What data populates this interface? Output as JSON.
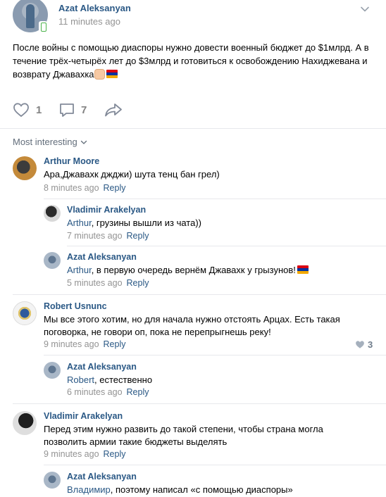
{
  "post": {
    "author": "Azat Aleksanyan",
    "time": "11 minutes ago",
    "text": "После войны с помощью диаспоры нужно довести военный бюджет до $1млрд. А в течение трёх-четырёх лет до $3млрд и готовиться к освобождению Нахиджевана и возврату Джавахка",
    "like_count": "1",
    "comment_count": "7",
    "icons": [
      "heart-icon",
      "comment-icon",
      "share-icon",
      "chevron-down-icon"
    ]
  },
  "comments_header": {
    "sort_label": "Most interesting"
  },
  "reply_label": "Reply",
  "comments": [
    {
      "author": "Arthur Moore",
      "text": "Ара,Джавахк джджи) шута тенц бан грел)",
      "time": "8 minutes ago"
    },
    {
      "author": "Vladimir Arakelyan",
      "mention": "Arthur",
      "text": ", грузины вышли из чата))",
      "time": "7 minutes ago"
    },
    {
      "author": "Azat Aleksanyan",
      "mention": "Arthur",
      "text": ", в первую очередь вернём Джавахк у грызунов!",
      "time": "5 minutes ago"
    },
    {
      "author": "Robert Usnunc",
      "text": "Мы все этого хотим, но для начала нужно отстоять Арцах. Есть такая поговорка, не говори оп, пока не перепрыгнешь реку!",
      "time": "9 minutes ago",
      "likes": "3"
    },
    {
      "author": "Azat Aleksanyan",
      "mention": "Robert",
      "text": ", естественно",
      "time": "6 minutes ago"
    },
    {
      "author": "Vladimir Arakelyan",
      "text": "Перед этим нужно развить до такой степени, чтобы страна могла позволить армии такие бюджеты выделять",
      "time": "9 minutes ago"
    },
    {
      "author": "Azat Aleksanyan",
      "mention": "Владимир",
      "text": ", поэтому написал «с помощью диаспоры»"
    }
  ],
  "colors": {
    "link": "#2a5885",
    "meta": "#939393",
    "divider": "#e7e8ec"
  }
}
